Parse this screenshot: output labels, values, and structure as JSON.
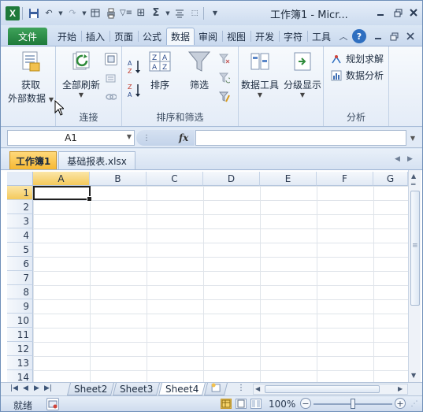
{
  "window": {
    "title": "工作簿1 - Micr...",
    "app_icon": "X",
    "minimize_icon": "minimize-icon",
    "restore_icon": "restore-icon",
    "close_icon": "close-icon"
  },
  "quick_access": [
    "save-icon",
    "undo-icon",
    "redo-icon",
    "format-icon",
    "print-icon",
    "filter-icon",
    "border-icon",
    "sum-icon",
    "align-icon",
    "customize-icon"
  ],
  "tabs": [
    {
      "label": "文件"
    },
    {
      "label": "开始"
    },
    {
      "label": "插入"
    },
    {
      "label": "页面"
    },
    {
      "label": "公式"
    },
    {
      "label": "数据"
    },
    {
      "label": "审阅"
    },
    {
      "label": "视图"
    },
    {
      "label": "开发"
    },
    {
      "label": "字符"
    },
    {
      "label": "工具"
    }
  ],
  "ribbon": {
    "get_external": {
      "line1": "获取",
      "line2": "外部数据"
    },
    "refresh_all": "全部刷新",
    "connections_group": "连接",
    "sort": "排序",
    "filter": "筛选",
    "sort_filter_group": "排序和筛选",
    "data_tools": "数据工具",
    "outline": "分级显示",
    "solver": "规划求解",
    "data_analysis": "数据分析",
    "analysis_group": "分析"
  },
  "formula_bar": {
    "name_box": "A1",
    "fx_label": "fx",
    "formula": ""
  },
  "workbooks": [
    {
      "label": "工作簿1",
      "active": true
    },
    {
      "label": "基础报表.xlsx",
      "active": false
    }
  ],
  "grid": {
    "columns": [
      "A",
      "B",
      "C",
      "D",
      "E",
      "F",
      "G"
    ],
    "rows": [
      "1",
      "2",
      "3",
      "4",
      "5",
      "6",
      "7",
      "8",
      "9",
      "10",
      "11",
      "12",
      "13",
      "14"
    ],
    "active_cell": "A1"
  },
  "sheets": [
    {
      "label": "Sheet2",
      "active": false
    },
    {
      "label": "Sheet3",
      "active": false
    },
    {
      "label": "Sheet4",
      "active": true
    }
  ],
  "status": {
    "ready": "就绪",
    "zoom": "100%",
    "zoom_level": 0.5
  }
}
